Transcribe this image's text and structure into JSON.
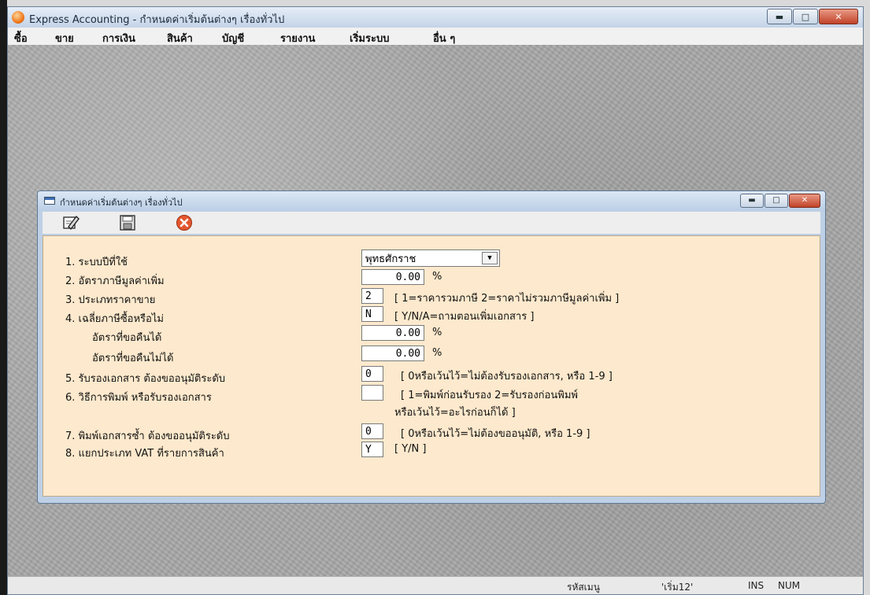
{
  "app": {
    "title": "Express Accounting - กำหนดค่าเริ่มต้นต่างๆ เรื่องทั่วไป"
  },
  "menu": [
    "ซื้อ",
    "ขาย",
    "การเงิน",
    "สินค้า",
    "บัญชี",
    "รายงาน",
    "เริ่มระบบ",
    "อื่น ๆ"
  ],
  "child": {
    "title": "กำหนดค่าเริ่มต้นต่างๆ เรื่องทั่วไป"
  },
  "toolbar": {
    "edit_icon": "edit-icon",
    "save_icon": "save-icon",
    "close_icon": "close-icon"
  },
  "form": {
    "row1": {
      "label": "1. ระบบปีที่ใช้",
      "value": "พุทธศักราช"
    },
    "row2": {
      "label": "2. อัตราภาษีมูลค่าเพิ่ม",
      "value": "0.00",
      "unit": "%"
    },
    "row3": {
      "label": "3. ประเภทราคาขาย",
      "value": "2",
      "hint": "[ 1=ราคารวมภาษี   2=ราคาไม่รวมภาษีมูลค่าเพิ่ม ]"
    },
    "row4": {
      "label": "4. เฉลี่ยภาษีซื้อหรือไม่",
      "value": "N",
      "hint": "[ Y/N/A=ถามตอนเพิ่มเอกสาร ]"
    },
    "row4a": {
      "label": "อัตราที่ขอคืนได้",
      "value": "0.00",
      "unit": "%"
    },
    "row4b": {
      "label": "อัตราที่ขอคืนไม่ได้",
      "value": "0.00",
      "unit": "%"
    },
    "row5": {
      "label": "5. รับรองเอกสาร ต้องขออนุมัติระดับ",
      "value": "0",
      "hint": "[ 0หรือเว้นไว้=ไม่ต้องรับรองเอกสาร,  หรือ 1-9 ]"
    },
    "row6": {
      "label": "6. วิธีการพิมพ์ หรือรับรองเอกสาร",
      "value": "",
      "hint": "[ 1=พิมพ์ก่อนรับรอง  2=รับรองก่อนพิมพ์",
      "hint2": "หรือเว้นไว้=อะไรก่อนก็ได้ ]"
    },
    "row7": {
      "label": "7. พิมพ์เอกสารซ้ำ ต้องขออนุมัติระดับ",
      "value": "0",
      "hint": "[ 0หรือเว้นไว้=ไม่ต้องขออนุมัติ,  หรือ 1-9 ]"
    },
    "row8": {
      "label": "8. แยกประเภท VAT ที่รายการสินค้า",
      "value": "Y",
      "hint": "[ Y/N ]"
    }
  },
  "status": {
    "label": "รหัสเมนู",
    "menu_code": "'เริ่ม12'",
    "ins": "INS",
    "num": "NUM"
  }
}
